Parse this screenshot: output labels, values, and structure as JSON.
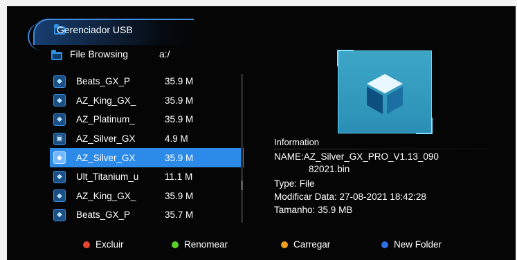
{
  "header": {
    "title": "Gerenciador USB",
    "icon": "folder-icon"
  },
  "browse": {
    "label": "File Browsing",
    "path": "a:/"
  },
  "files": [
    {
      "name": "Beats_GX_P",
      "size": "35.9 M",
      "icon": "package-icon"
    },
    {
      "name": "AZ_King_GX_",
      "size": "35.9 M",
      "icon": "package-icon"
    },
    {
      "name": "AZ_Platinum_",
      "size": "35.9 M",
      "icon": "package-icon"
    },
    {
      "name": "AZ_Silver_GX",
      "size": "4.9 M",
      "icon": "disk-icon"
    },
    {
      "name": "AZ_Silver_GX",
      "size": "35.9 M",
      "icon": "package-icon",
      "selected": true
    },
    {
      "name": "Ult_Titanium_u",
      "size": "11.1 M",
      "icon": "package-icon"
    },
    {
      "name": "AZ_King_GX_",
      "size": "35.9 M",
      "icon": "package-icon"
    },
    {
      "name": "Beats_GX_P",
      "size": "35.7 M",
      "icon": "package-icon"
    }
  ],
  "info": {
    "title": "Information",
    "name_line1": "NAME:AZ_Silver_GX_PRO_V1.13_090",
    "name_line2": "82021.bin",
    "type": "Type: File",
    "modified": "Modificar Data: 27-08-2021 18:42:28",
    "size": "Tamanho: 35.9 MB"
  },
  "actions": [
    {
      "label": "Excluir",
      "color": "#e8452c"
    },
    {
      "label": "Renomear",
      "color": "#5bd12a"
    },
    {
      "label": "Carregar",
      "color": "#f2a01b"
    },
    {
      "label": "New Folder",
      "color": "#2e6fe8"
    }
  ]
}
